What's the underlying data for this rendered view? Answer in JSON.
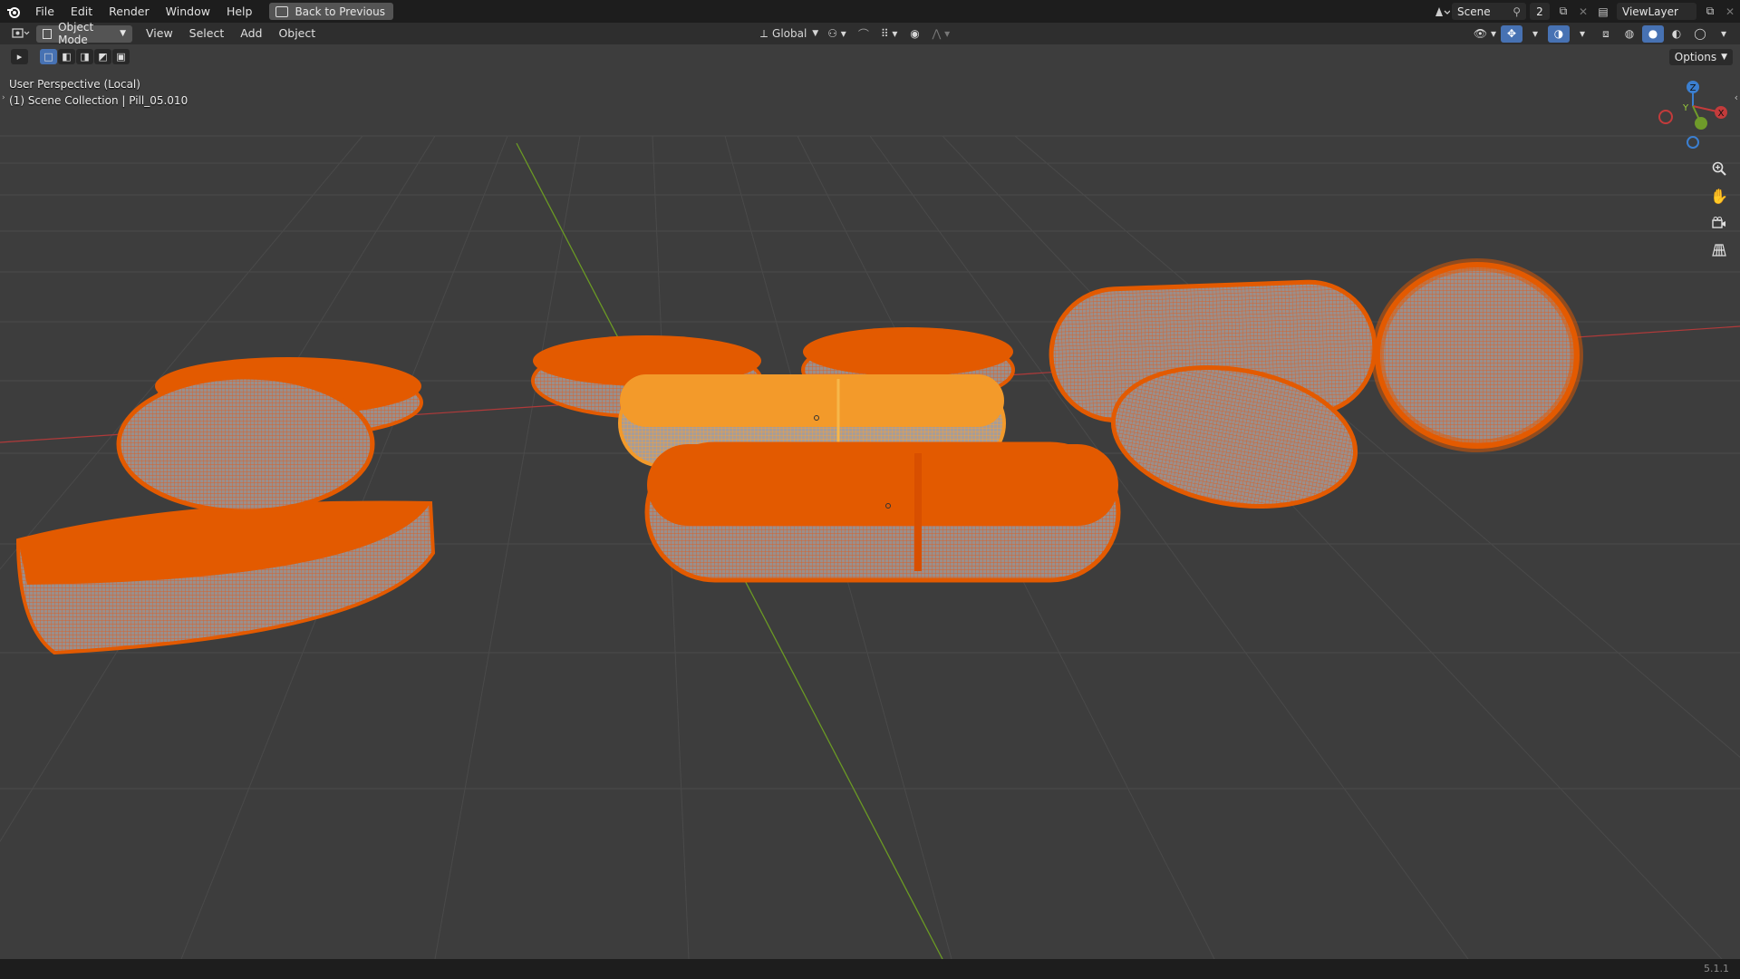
{
  "topbar": {
    "menus": [
      "File",
      "Edit",
      "Render",
      "Window",
      "Help"
    ],
    "back_label": "Back to Previous",
    "scene_name": "Scene",
    "scene_users": "2",
    "view_layer": "ViewLayer"
  },
  "header": {
    "mode": "Object Mode",
    "menus": [
      "View",
      "Select",
      "Add",
      "Object"
    ],
    "transform_orientation": "Global"
  },
  "viewport": {
    "perspective_label": "User Perspective (Local)",
    "collection_label": "(1) Scene Collection | Pill_05.010",
    "options_label": "Options",
    "gizmo": {
      "x": "X",
      "y": "Y",
      "z": "Z"
    },
    "selected_color": "#e35a00",
    "active_color": "#f39a2a",
    "axis_x_color": "#c33b3b",
    "axis_y_color": "#6f9b2a"
  },
  "status": {
    "version": "5.1.1"
  }
}
